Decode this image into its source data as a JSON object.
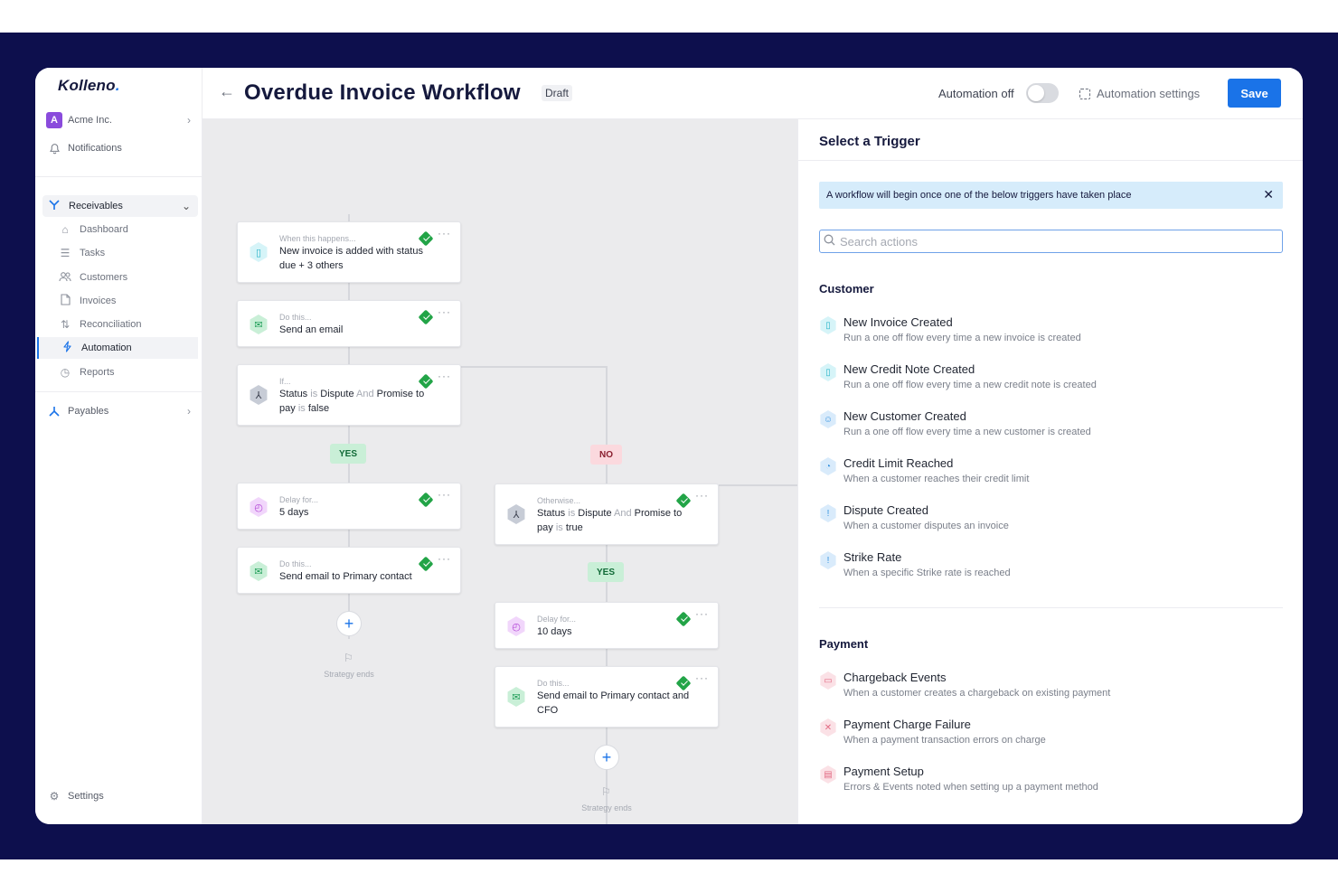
{
  "sidebar": {
    "logo": "Kolleno",
    "org": {
      "badge": "A",
      "name": "Acme Inc."
    },
    "notifications": "Notifications",
    "receivables": "Receivables",
    "items": [
      {
        "label": "Dashboard",
        "icon": "home-icon"
      },
      {
        "label": "Tasks",
        "icon": "tasks-icon"
      },
      {
        "label": "Customers",
        "icon": "users-icon"
      },
      {
        "label": "Invoices",
        "icon": "document-icon"
      },
      {
        "label": "Reconciliation",
        "icon": "swap-icon"
      },
      {
        "label": "Automation",
        "icon": "bolt-icon",
        "active": true
      },
      {
        "label": "Reports",
        "icon": "clock-icon"
      }
    ],
    "payables": "Payables",
    "settings": "Settings"
  },
  "header": {
    "title": "Overdue Invoice Workflow",
    "status": "Draft",
    "automation_label": "Automation off",
    "automation_enabled": false,
    "settings_label": "Automation settings",
    "save_label": "Save"
  },
  "workflow": {
    "trigger": {
      "pre": "When this happens...",
      "text": "New invoice is added with status due + 3 others"
    },
    "email1": {
      "pre": "Do this...",
      "text": "Send an email"
    },
    "cond1": {
      "pre": "If...",
      "a": "Status",
      "is1": "is",
      "b": "Dispute",
      "and": "And",
      "c": "Promise to pay",
      "is2": "is",
      "d": "false"
    },
    "yes": "YES",
    "no": "NO",
    "delay1": {
      "pre": "Delay for...",
      "text": "5 days"
    },
    "email2": {
      "pre": "Do this...",
      "text": "Send email to Primary contact"
    },
    "cond2": {
      "pre": "Otherwise...",
      "a": "Status",
      "is1": "is",
      "b": "Dispute",
      "and": "And",
      "c": "Promise to pay",
      "is2": "is",
      "d": "true"
    },
    "yes2": "YES",
    "delay2": {
      "pre": "Delay for...",
      "text": "10 days"
    },
    "email3": {
      "pre": "Do this...",
      "text": "Send email to Primary contact and CFO"
    },
    "ends": "Strategy ends",
    "ends2": "Strategy ends"
  },
  "panel": {
    "title": "Select a Trigger",
    "banner": "A workflow will begin once one of the below triggers have taken place",
    "search_placeholder": "Search actions",
    "customer_heading": "Customer",
    "customer_triggers": [
      {
        "name": "New Invoice Created",
        "desc": "Run a one off flow every time a new invoice is created",
        "icon": "document-icon"
      },
      {
        "name": "New Credit Note Created",
        "desc": "Run a one off flow every time a new credit note is created",
        "icon": "document-icon"
      },
      {
        "name": "New Customer Created",
        "desc": "Run a one off flow every time a new customer is created",
        "icon": "users-icon"
      },
      {
        "name": "Credit Limit Reached",
        "desc": "When a customer reaches their credit limit",
        "icon": "gauge-icon"
      },
      {
        "name": "Dispute Created",
        "desc": "When a customer disputes an invoice",
        "icon": "alert-icon"
      },
      {
        "name": "Strike Rate",
        "desc": "When a specific Strike rate is reached",
        "icon": "alert-icon"
      }
    ],
    "payment_heading": "Payment",
    "payment_triggers": [
      {
        "name": "Chargeback Events",
        "desc": "When a customer creates a chargeback on existing payment",
        "icon": "money-icon"
      },
      {
        "name": "Payment Charge Failure",
        "desc": "When a payment transaction errors on charge",
        "icon": "cart-icon"
      },
      {
        "name": "Payment Setup",
        "desc": "Errors & Events noted when setting up a payment method",
        "icon": "card-icon"
      }
    ]
  },
  "colors": {
    "accent": "#1a73e8",
    "background_band": "#0d0f4d",
    "success": "#22a447"
  }
}
